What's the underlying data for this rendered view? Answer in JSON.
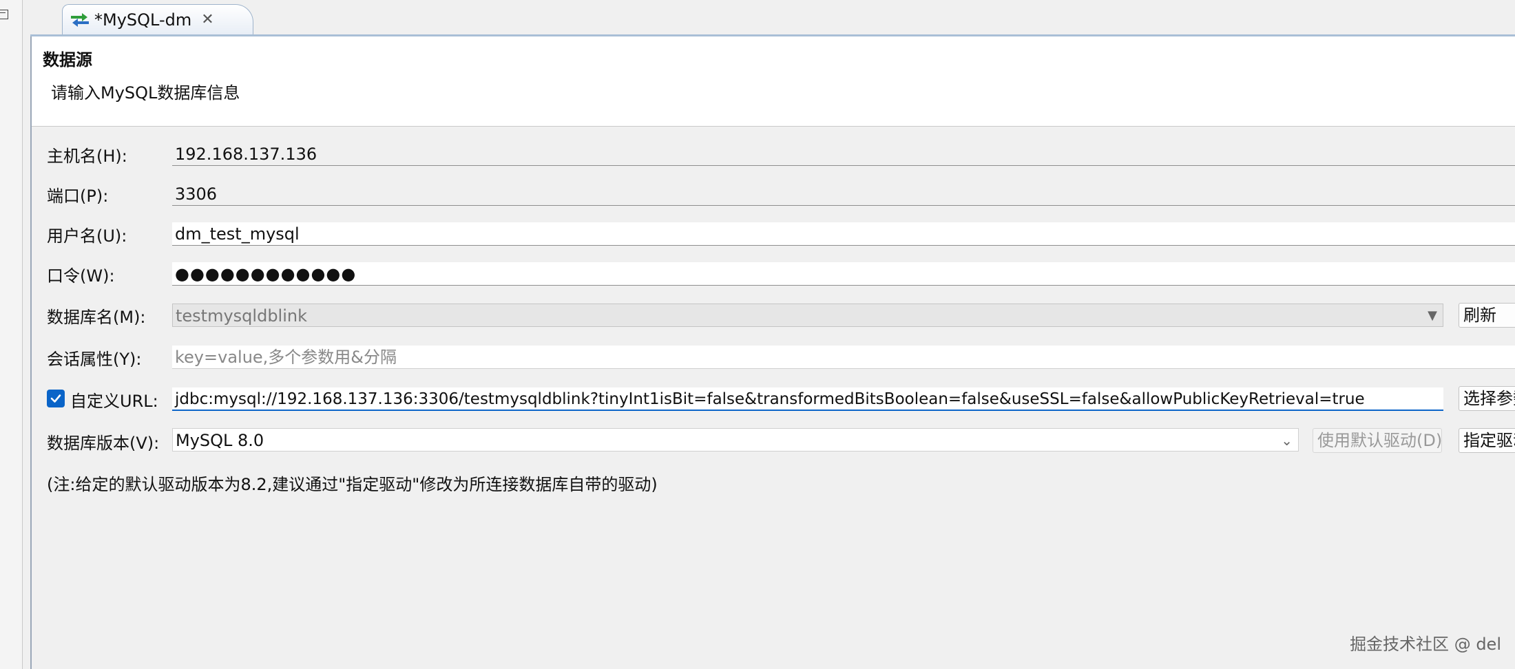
{
  "tab": {
    "title": "*MySQL-dm",
    "close_glyph": "✕",
    "icon": "swap-arrows-icon"
  },
  "header": {
    "title": "数据源",
    "description": "请输入MySQL数据库信息"
  },
  "form": {
    "host": {
      "label": "主机名(H):",
      "value": "192.168.137.136"
    },
    "port": {
      "label": "端口(P):",
      "value": "3306"
    },
    "username": {
      "label": "用户名(U):",
      "value": "dm_test_mysql"
    },
    "password": {
      "label": "口令(W):",
      "value": "●●●●●●●●●●●●"
    },
    "database": {
      "label": "数据库名(M):",
      "value": "testmysqldblink",
      "refresh_button": "刷新"
    },
    "session_props": {
      "label": "会话属性(Y):",
      "placeholder": "key=value,多个参数用&分隔"
    },
    "custom_url": {
      "checked": true,
      "label": "自定义URL:",
      "value": "jdbc:mysql://192.168.137.136:3306/testmysqldblink?tinyInt1isBit=false&transformedBitsBoolean=false&useSSL=false&allowPublicKeyRetrieval=true",
      "select_params_button": "选择参数"
    },
    "db_version": {
      "label": "数据库版本(V):",
      "value": "MySQL 8.0",
      "default_driver_button": "使用默认驱动(D)",
      "specify_driver_button": "指定驱动"
    },
    "note": "(注:给定的默认驱动版本为8.2,建议通过\"指定驱动\"修改为所连接数据库自带的驱动)"
  },
  "watermark": "掘金技术社区 @ del",
  "colors": {
    "accent": "#0a64c8",
    "tab_border": "#a9bfd6"
  }
}
